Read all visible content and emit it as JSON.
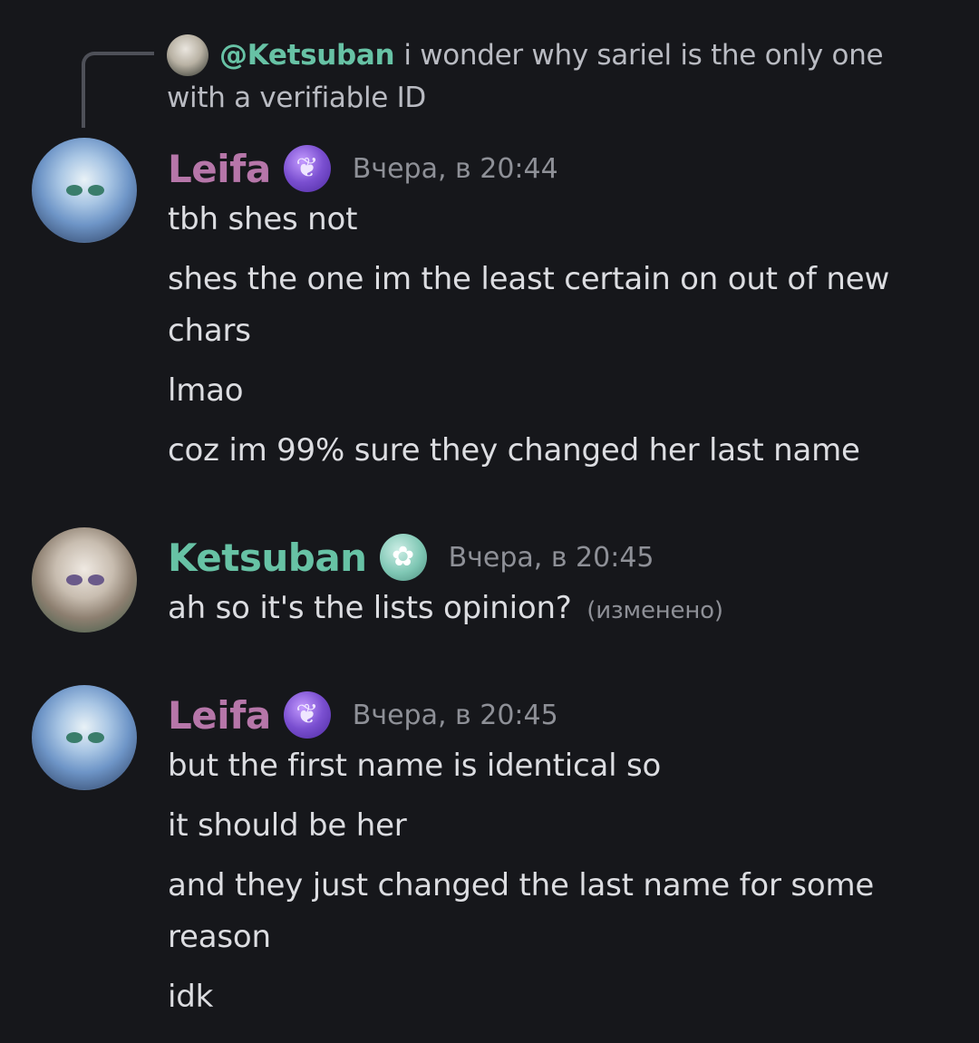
{
  "reply": {
    "mention": "@Ketsuban",
    "text": "i wonder why sariel is the only one with a verifiable ID"
  },
  "messages": [
    {
      "author": "Leifa",
      "author_color": "#b676a9",
      "badge": "purple-leaf-badge",
      "timestamp": "Вчера, в 20:44",
      "lines": [
        "tbh shes not",
        "shes the one im the least certain on out of new chars",
        "lmao",
        "coz im 99% sure they changed her last name"
      ]
    },
    {
      "author": "Ketsuban",
      "author_color": "#67c2a5",
      "badge": "teal-cucumber-badge",
      "timestamp": "Вчера, в 20:45",
      "lines": [
        "ah so it's the lists opinion?"
      ],
      "edited_label": "(изменено)"
    },
    {
      "author": "Leifa",
      "author_color": "#b676a9",
      "badge": "purple-leaf-badge",
      "timestamp": "Вчера, в 20:45",
      "lines": [
        "but the first name is identical so",
        "it should be her",
        "and they just changed the last name for some reason",
        "idk"
      ]
    }
  ]
}
